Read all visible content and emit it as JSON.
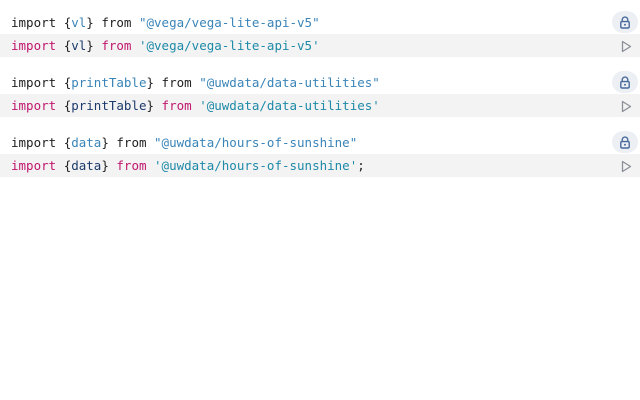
{
  "cells": [
    {
      "output": {
        "kw": "import",
        "open": "{",
        "name": "vl",
        "close": "}",
        "from": "from",
        "source": "\"@vega/vega-lite-api-v5\""
      },
      "input": {
        "kw": "import",
        "open": "{",
        "name": "vl",
        "close": "}",
        "from": "from",
        "source": "'@vega/vega-lite-api-v5'",
        "end": ""
      }
    },
    {
      "output": {
        "kw": "import",
        "open": "{",
        "name": "printTable",
        "close": "}",
        "from": "from",
        "source": "\"@uwdata/data-utilities\""
      },
      "input": {
        "kw": "import",
        "open": "{",
        "name": "printTable",
        "close": "}",
        "from": "from",
        "source": "'@uwdata/data-utilities'",
        "end": ""
      }
    },
    {
      "output": {
        "kw": "import",
        "open": "{",
        "name": "data",
        "close": "}",
        "from": "from",
        "source": "\"@uwdata/hours-of-sunshine\""
      },
      "input": {
        "kw": "import",
        "open": "{",
        "name": "data",
        "close": "}",
        "from": "from",
        "source": "'@uwdata/hours-of-sunshine'",
        "end": ";"
      }
    }
  ],
  "icons": {
    "lock": "lock-icon",
    "run": "play-icon"
  },
  "colors": {
    "keyword": "#c0176d",
    "identifier_output": "#3a84b8",
    "string_output": "#3a84b8",
    "identifier_input": "#1c3a6b",
    "string_input": "#1d8aa8",
    "input_background": "#f3f3f3",
    "lock_button_background": "#eceff3",
    "icon_color": "#4a6a9c"
  }
}
